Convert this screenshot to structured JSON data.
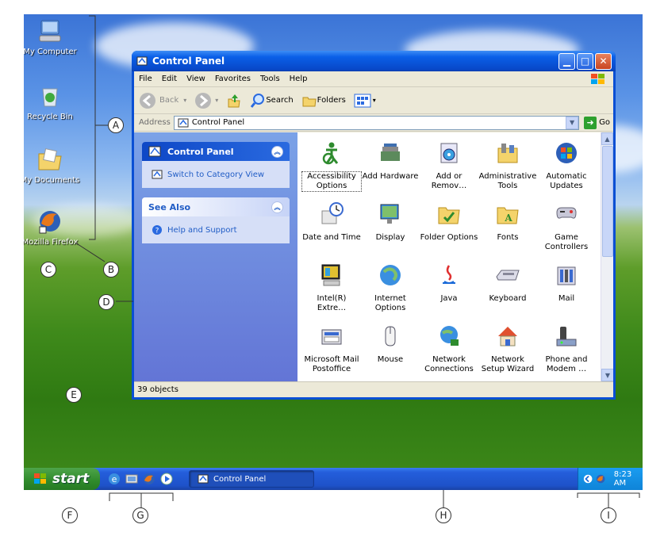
{
  "desktop": {
    "icons": [
      {
        "label": "My Computer",
        "icon": "my-computer-icon"
      },
      {
        "label": "Recycle Bin",
        "icon": "recycle-bin-icon"
      },
      {
        "label": "My Documents",
        "icon": "my-documents-icon"
      },
      {
        "label": "Mozilla Firefox",
        "icon": "firefox-icon"
      }
    ]
  },
  "window": {
    "title": "Control Panel",
    "menu": [
      "File",
      "Edit",
      "View",
      "Favorites",
      "Tools",
      "Help"
    ],
    "toolbar": {
      "back": "Back",
      "search": "Search",
      "folders": "Folders"
    },
    "address": {
      "label": "Address",
      "value": "Control Panel",
      "go": "Go"
    },
    "taskpane": {
      "control_panel": {
        "title": "Control Panel",
        "item": "Switch to Category View"
      },
      "see_also": {
        "title": "See Also",
        "item": "Help and Support"
      }
    },
    "items": [
      {
        "label": "Accessibility Options",
        "icon": "accessibility-icon"
      },
      {
        "label": "Add Hardware",
        "icon": "add-hardware-icon"
      },
      {
        "label": "Add or Remov…",
        "icon": "add-remove-programs-icon"
      },
      {
        "label": "Administrative Tools",
        "icon": "administrative-tools-icon"
      },
      {
        "label": "Automatic Updates",
        "icon": "automatic-updates-icon"
      },
      {
        "label": "Date and Time",
        "icon": "date-time-icon"
      },
      {
        "label": "Display",
        "icon": "display-icon"
      },
      {
        "label": "Folder Options",
        "icon": "folder-options-icon"
      },
      {
        "label": "Fonts",
        "icon": "fonts-icon"
      },
      {
        "label": "Game Controllers",
        "icon": "game-controllers-icon"
      },
      {
        "label": "Intel(R) Extre…",
        "icon": "intel-graphics-icon"
      },
      {
        "label": "Internet Options",
        "icon": "internet-options-icon"
      },
      {
        "label": "Java",
        "icon": "java-icon"
      },
      {
        "label": "Keyboard",
        "icon": "keyboard-icon"
      },
      {
        "label": "Mail",
        "icon": "mail-icon"
      },
      {
        "label": "Microsoft Mail Postoffice",
        "icon": "mail-postoffice-icon"
      },
      {
        "label": "Mouse",
        "icon": "mouse-icon"
      },
      {
        "label": "Network Connections",
        "icon": "network-connections-icon"
      },
      {
        "label": "Network Setup Wizard",
        "icon": "network-setup-icon"
      },
      {
        "label": "Phone and Modem …",
        "icon": "phone-modem-icon"
      }
    ],
    "status": "39 objects"
  },
  "taskbar": {
    "start": "start",
    "task": "Control Panel",
    "clock": "8:23 AM"
  },
  "callouts": [
    "A",
    "B",
    "C",
    "D",
    "E",
    "F",
    "G",
    "H",
    "I"
  ]
}
